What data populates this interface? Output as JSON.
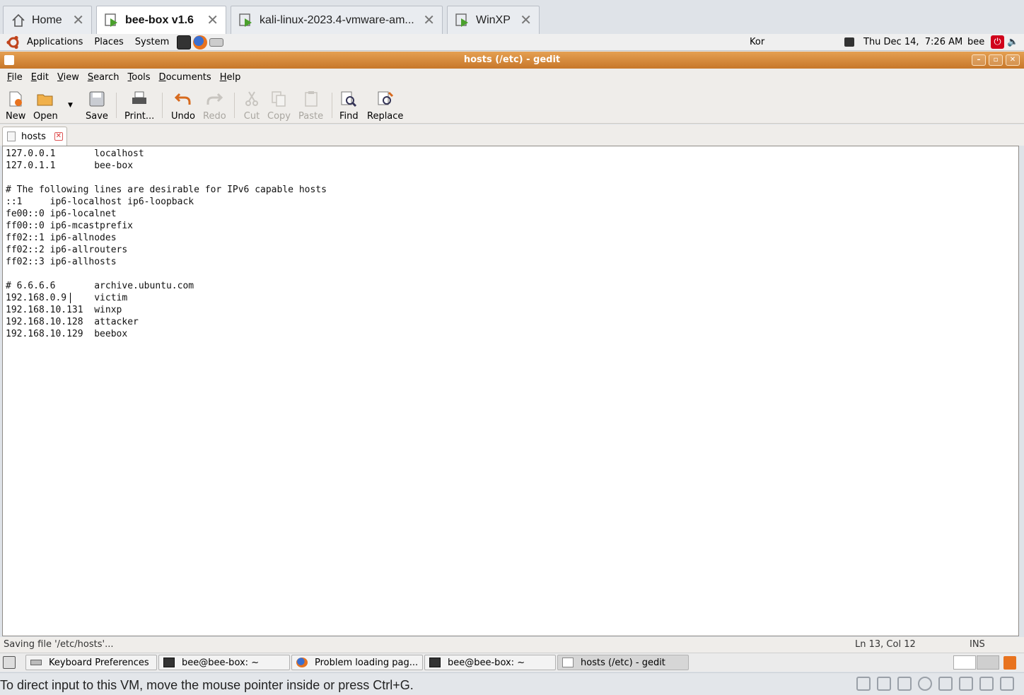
{
  "vm_tabs": [
    {
      "label": "Home",
      "icon": "home-icon"
    },
    {
      "label": "bee-box v1.6",
      "icon": "vm-icon"
    },
    {
      "label": "kali-linux-2023.4-vmware-am...",
      "icon": "vm-icon"
    },
    {
      "label": "WinXP",
      "icon": "vm-icon"
    }
  ],
  "gnome_panel": {
    "menus": [
      "Applications",
      "Places",
      "System"
    ],
    "keyboard_layout": "Kor",
    "datetime": "Thu Dec 14,  7:26 AM",
    "user": "bee"
  },
  "window": {
    "title": "hosts (/etc) - gedit"
  },
  "menubar": [
    "File",
    "Edit",
    "View",
    "Search",
    "Tools",
    "Documents",
    "Help"
  ],
  "toolbar": {
    "new": "New",
    "open": "Open",
    "save": "Save",
    "print": "Print...",
    "undo": "Undo",
    "redo": "Redo",
    "cut": "Cut",
    "copy": "Copy",
    "paste": "Paste",
    "find": "Find",
    "replace": "Replace"
  },
  "document_tab": {
    "label": "hosts"
  },
  "editor_lines": [
    "127.0.0.1\tlocalhost",
    "127.0.1.1\tbee-box",
    "",
    "# The following lines are desirable for IPv6 capable hosts",
    "::1     ip6-localhost ip6-loopback",
    "fe00::0 ip6-localnet",
    "ff00::0 ip6-mcastprefix",
    "ff02::1 ip6-allnodes",
    "ff02::2 ip6-allrouters",
    "ff02::3 ip6-allhosts",
    "",
    "# 6.6.6.6\tarchive.ubuntu.com",
    "192.168.0.9\tvictim",
    "192.168.10.131\twinxp",
    "192.168.10.128\tattacker",
    "192.168.10.129\tbeebox"
  ],
  "statusbar": {
    "message": "Saving file '/etc/hosts'...",
    "position": "Ln 13, Col 12",
    "mode": "INS"
  },
  "taskbar": [
    {
      "label": "Keyboard Preferences",
      "icon": "keyboard-icon"
    },
    {
      "label": "bee@bee-box: ~",
      "icon": "terminal-icon"
    },
    {
      "label": "Problem loading pag...",
      "icon": "firefox-icon"
    },
    {
      "label": "bee@bee-box: ~",
      "icon": "terminal-icon"
    },
    {
      "label": "hosts (/etc) - gedit",
      "icon": "gedit-icon"
    }
  ],
  "vm_status": {
    "message": "To direct input to this VM, move the mouse pointer inside or press Ctrl+G."
  },
  "colors": {
    "titlebar": "#d98a3a",
    "vm_icon_green": "#4aa02c",
    "power_red": "#d0021b"
  }
}
